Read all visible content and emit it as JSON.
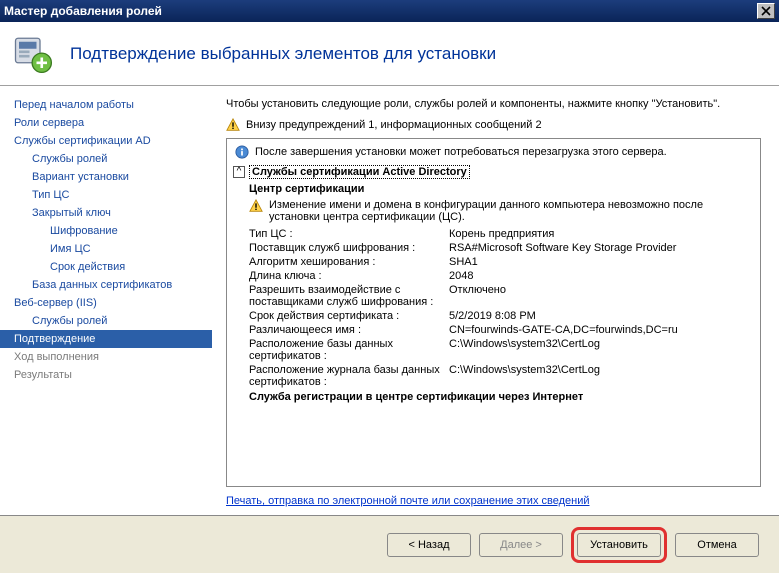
{
  "window": {
    "title": "Мастер добавления ролей"
  },
  "header": {
    "title": "Подтверждение выбранных элементов для установки"
  },
  "sidebar": {
    "items": [
      {
        "label": "Перед началом работы",
        "indent": 0
      },
      {
        "label": "Роли сервера",
        "indent": 0
      },
      {
        "label": "Службы сертификации AD",
        "indent": 0
      },
      {
        "label": "Службы ролей",
        "indent": 1
      },
      {
        "label": "Вариант установки",
        "indent": 1
      },
      {
        "label": "Тип ЦС",
        "indent": 1
      },
      {
        "label": "Закрытый ключ",
        "indent": 1
      },
      {
        "label": "Шифрование",
        "indent": 2
      },
      {
        "label": "Имя ЦС",
        "indent": 2
      },
      {
        "label": "Срок действия",
        "indent": 2
      },
      {
        "label": "База данных сертификатов",
        "indent": 1
      },
      {
        "label": "Веб-сервер (IIS)",
        "indent": 0
      },
      {
        "label": "Службы ролей",
        "indent": 1
      },
      {
        "label": "Подтверждение",
        "indent": 0,
        "active": true
      },
      {
        "label": "Ход выполнения",
        "indent": 0,
        "muted": true
      },
      {
        "label": "Результаты",
        "indent": 0,
        "muted": true
      }
    ]
  },
  "main": {
    "instruction": "Чтобы установить следующие роли, службы ролей и компоненты, нажмите кнопку \"Установить\".",
    "warnings_line": "Внизу предупреждений 1, информационных сообщений 2",
    "info_line": "После завершения установки может потребоваться перезагрузка этого сервера.",
    "section_title": "Службы сертификации Active Directory",
    "sub_heading": "Центр сертификации",
    "inner_warning": "Изменение имени и домена в конфигурации данного компьютера невозможно после установки центра сертификации (ЦС).",
    "kv": [
      {
        "k": "Тип ЦС :",
        "v": "Корень предприятия"
      },
      {
        "k": "Поставщик служб шифрования :",
        "v": "RSA#Microsoft Software Key Storage Provider"
      },
      {
        "k": "Алгоритм хеширования :",
        "v": "SHA1"
      },
      {
        "k": "Длина ключа :",
        "v": "2048"
      },
      {
        "k": "Разрешить взаимодействие с поставщиками служб шифрования :",
        "v": "Отключено"
      },
      {
        "k": "Срок действия сертификата :",
        "v": "5/2/2019 8:08 PM"
      },
      {
        "k": "Различающееся имя :",
        "v": "CN=fourwinds-GATE-CA,DC=fourwinds,DC=ru"
      },
      {
        "k": "Расположение базы данных сертификатов :",
        "v": "C:\\Windows\\system32\\CertLog"
      },
      {
        "k": "Расположение журнала базы данных сертификатов :",
        "v": "C:\\Windows\\system32\\CertLog"
      }
    ],
    "sub_heading2": "Служба регистрации в центре сертификации через Интернет",
    "link": "Печать, отправка по электронной почте или сохранение этих сведений"
  },
  "footer": {
    "back": "< Назад",
    "next": "Далее >",
    "install": "Установить",
    "cancel": "Отмена"
  }
}
